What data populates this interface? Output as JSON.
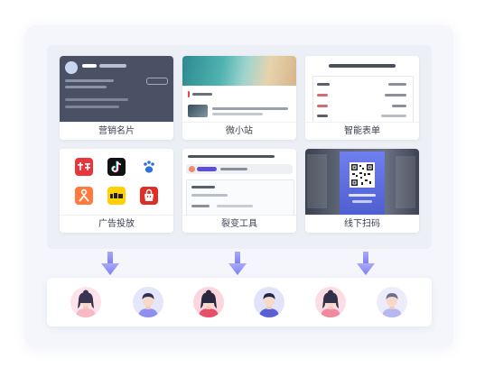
{
  "cards": [
    {
      "label": "营销名片"
    },
    {
      "label": "微小站"
    },
    {
      "label": "智能表单"
    },
    {
      "label": "广告投放"
    },
    {
      "label": "裂变工具"
    },
    {
      "label": "线下扫码"
    }
  ],
  "ad_platform_icons": [
    "toutiao-icon",
    "douyin-icon",
    "baidu-icon",
    "kuaishou-icon",
    "meituan-icon",
    "pinduoduo-icon"
  ],
  "avatars": [
    {
      "icon": "female-user-avatar-icon",
      "bg": "#fde3ea",
      "body": "#f7b9c6",
      "hair": "#3a3550"
    },
    {
      "icon": "male-user-avatar-icon",
      "bg": "#e5e5fb",
      "body": "#8f8ff0",
      "hair": "#2f3258"
    },
    {
      "icon": "female-user-avatar-icon",
      "bg": "#fbd6de",
      "body": "#e84d6a",
      "hair": "#2a2740"
    },
    {
      "icon": "male-user-avatar-icon",
      "bg": "#e2e2fa",
      "body": "#5b5fd6",
      "hair": "#24264a"
    },
    {
      "icon": "female-user-avatar-icon",
      "bg": "#fcdde3",
      "body": "#f08aa0",
      "hair": "#33304a"
    },
    {
      "icon": "male-user-avatar-icon",
      "bg": "#ececfb",
      "body": "#b7b8f2",
      "hair": "#6c6f95"
    }
  ],
  "colors": {
    "accent": "#8b8cf2",
    "outer_panel": "#f4f6fb",
    "grid_panel": "#eceff5",
    "card_dark": "#4a5164"
  }
}
